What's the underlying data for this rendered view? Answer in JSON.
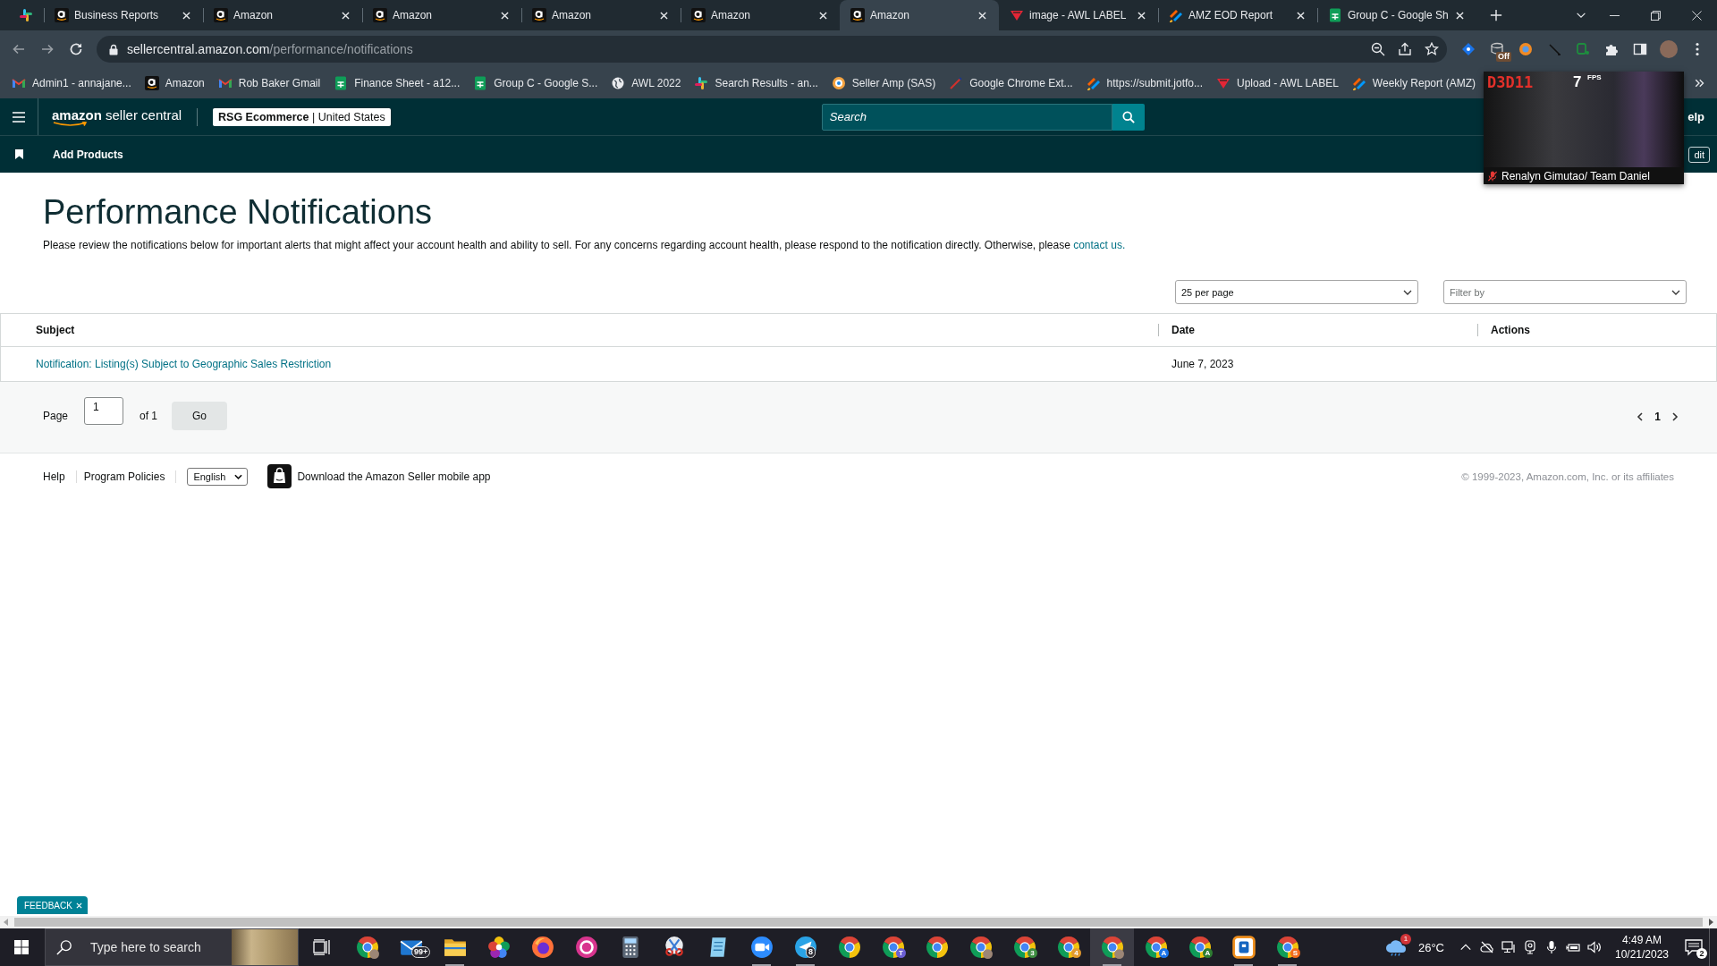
{
  "browser": {
    "tabs": [
      {
        "title": "Business Reports",
        "selected": false
      },
      {
        "title": "Amazon",
        "selected": false
      },
      {
        "title": "Amazon",
        "selected": false
      },
      {
        "title": "Amazon",
        "selected": false
      },
      {
        "title": "Amazon",
        "selected": false
      },
      {
        "title": "Amazon",
        "selected": true
      },
      {
        "title": "image - AWL LABEL",
        "selected": false
      },
      {
        "title": "AMZ EOD Report",
        "selected": false
      },
      {
        "title": "Group C - Google Sh",
        "selected": false
      }
    ],
    "address": {
      "domain": "sellercentral.amazon.com",
      "path": "/performance/notifications"
    },
    "extension_badge": "Off",
    "bookmarks": [
      {
        "title": "Admin1 - annajane..."
      },
      {
        "title": "Amazon"
      },
      {
        "title": "Rob Baker Gmail"
      },
      {
        "title": "Finance Sheet - a12..."
      },
      {
        "title": "Group C - Google S..."
      },
      {
        "title": "AWL 2022"
      },
      {
        "title": "Search Results - an..."
      },
      {
        "title": "Seller Amp (SAS)"
      },
      {
        "title": "Google Chrome Ext..."
      },
      {
        "title": "https://submit.jotfo..."
      },
      {
        "title": "Upload - AWL LABEL"
      },
      {
        "title": "Weekly Report (AMZ)"
      }
    ]
  },
  "overlay": {
    "renderer": "D3D11",
    "fps": "7",
    "fps_unit": "FPS",
    "caption": "Renalyn Gimutao/ Team Daniel",
    "mic_muted": true
  },
  "header": {
    "logo": "**amazon** seller central",
    "account": "**RSG Ecommerce** | United States",
    "search": {
      "placeholder": "Search"
    },
    "help_link": "elp",
    "nav": [
      {
        "label": "Add Products"
      }
    ],
    "edit_button": "dit"
  },
  "page": {
    "title": "Performance Notifications",
    "intro": "Please review the notifications below for important alerts that might affect your account health and ability to sell. For any concerns regarding account health, please respond to the notification directly. Otherwise, please",
    "intro_link": "contact us.",
    "page_size": {
      "value": "25 per page"
    },
    "filter": {
      "placeholder": "Filter by"
    }
  },
  "table": {
    "columns": [
      "Subject",
      "Date",
      "Actions"
    ],
    "rows": [
      {
        "subject": "Notification: Listing(s) Subject to Geographic Sales Restriction",
        "date": "June 7, 2023"
      }
    ]
  },
  "pagination": {
    "label": "Page",
    "page": "1",
    "total": "of 1",
    "go": "Go",
    "pages": [
      {
        "label": "1",
        "selected": true
      }
    ]
  },
  "footer": {
    "links": [
      "Help",
      "Program Policies"
    ],
    "language": "English",
    "app_promo": "Download the Amazon Seller mobile app",
    "copyright": "© 1999-2023, Amazon.com, Inc. or its affiliates"
  },
  "feedback": {
    "label": "FEEDBACK"
  },
  "taskbar": {
    "search": {
      "placeholder": "Type here to search"
    },
    "apps": [
      {
        "selected": false,
        "running": false
      },
      {
        "badge": "99+",
        "selected": false,
        "running": false
      },
      {
        "selected": false,
        "running": true
      },
      {
        "selected": false,
        "running": false
      },
      {
        "selected": false,
        "running": false
      },
      {
        "selected": false,
        "running": false
      },
      {
        "selected": false,
        "running": false
      },
      {
        "selected": false,
        "running": false
      },
      {
        "selected": false,
        "running": false
      },
      {
        "selected": false,
        "running": true
      },
      {
        "badge": "8",
        "selected": false,
        "running": true
      },
      {
        "selected": false,
        "running": false
      },
      {
        "badge": "T",
        "color": "#6b5fd3",
        "selected": false,
        "running": false
      },
      {
        "selected": false,
        "running": false
      },
      {
        "selected": false,
        "running": false
      },
      {
        "badge": "3",
        "color": "#3e8e41",
        "selected": false,
        "running": false
      },
      {
        "badge": "4",
        "color": "#e39a2d",
        "selected": false,
        "running": false
      },
      {
        "selected": true,
        "running": true
      },
      {
        "badge": "A",
        "color": "#1a73e8",
        "selected": false,
        "running": false
      },
      {
        "badge": "A",
        "color": "#2e7d32",
        "selected": false,
        "running": false
      },
      {
        "selected": false,
        "running": true
      },
      {
        "badge": "S",
        "color": "#f26b1d",
        "selected": false,
        "running": true
      }
    ],
    "weather": {
      "temperature": "26°C",
      "badge": "1"
    },
    "clock": {
      "time": "4:49 AM",
      "date": "10/21/2023"
    },
    "notifications": "2"
  }
}
